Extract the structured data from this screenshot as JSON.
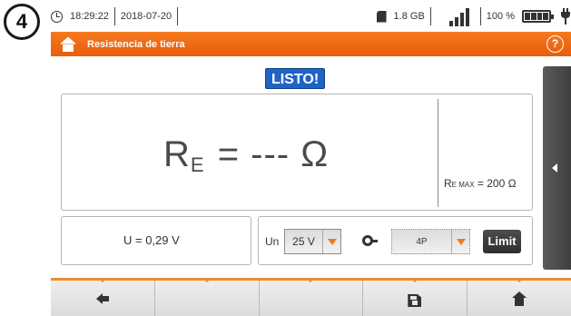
{
  "callout": "4",
  "status": {
    "time": "18:29:22",
    "date": "2018-07-20",
    "storage": "1.8 GB",
    "battery": "100 %",
    "signal_bars": 4
  },
  "title": {
    "text": "Resistencia de tierra",
    "help": "?",
    "bar_color": "#f07020"
  },
  "badge": {
    "ready": "LISTO!",
    "color": "#1f63c6"
  },
  "measurement": {
    "symbol": "R",
    "subscript": "E",
    "value_text": " = --- Ω",
    "max_prefix": "R",
    "max_sub": "E MAX",
    "max_value": " = 200 Ω",
    "voltage": "U = 0,29 V"
  },
  "controls": {
    "un_label": "Un",
    "un_value": "25 V",
    "mode_value": "4P",
    "limit_label": "Limit",
    "accent": "#ee7a1c"
  },
  "toolbar": {
    "buttons": [
      "back-arrow-icon",
      "",
      "",
      "save-icon",
      "home-icon"
    ]
  }
}
